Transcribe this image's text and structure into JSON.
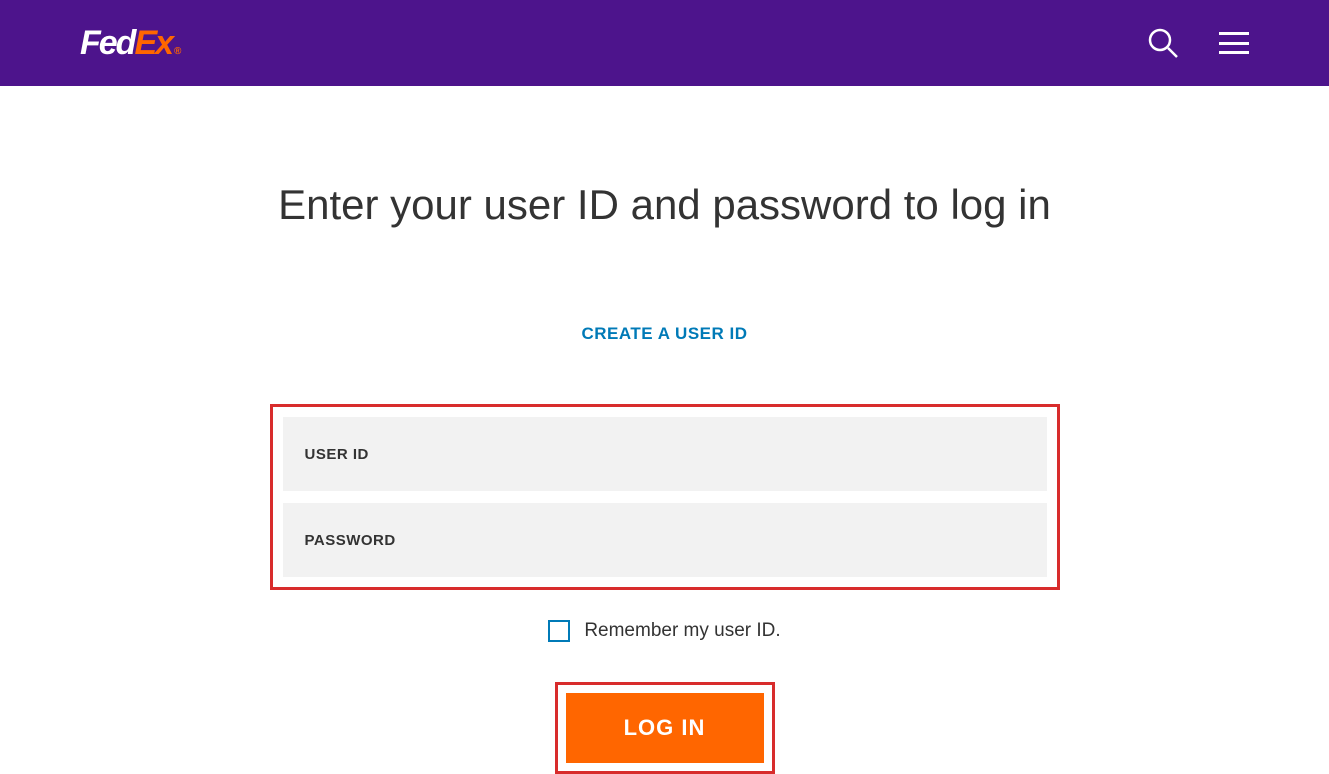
{
  "header": {
    "logo": {
      "part1": "Fed",
      "part2": "Ex",
      "suffix": "®"
    }
  },
  "main": {
    "title": "Enter your user ID and password to log in",
    "create_link": "CREATE A USER ID",
    "fields": {
      "userid_label": "USER ID",
      "password_label": "PASSWORD"
    },
    "remember_label": "Remember my user ID.",
    "login_button": "LOG IN"
  },
  "colors": {
    "brand_purple": "#4d148c",
    "brand_orange": "#ff6600",
    "link_blue": "#007ab7",
    "highlight_red": "#d82c2c"
  }
}
